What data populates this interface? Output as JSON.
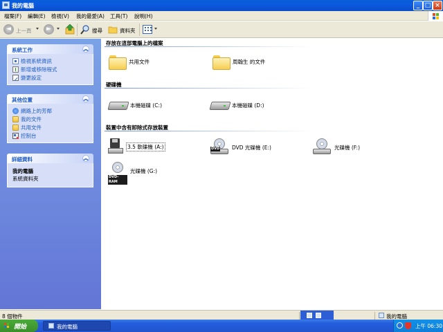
{
  "window": {
    "title": "我的電腦"
  },
  "menu": [
    "檔案(F)",
    "編輯(E)",
    "檢視(V)",
    "我的最愛(A)",
    "工具(T)",
    "說明(H)"
  ],
  "toolbar": {
    "back": "上一頁",
    "search": "搜尋",
    "folders": "資料夾"
  },
  "sidebar": {
    "system_tasks": {
      "title": "系統工作",
      "items": [
        "檢視系統資訊",
        "新增或移除程式",
        "變更設定"
      ]
    },
    "other_places": {
      "title": "其他位置",
      "items": [
        "網路上的芳鄰",
        "我的文件",
        "共用文件",
        "控制台"
      ]
    },
    "details": {
      "title": "詳細資料",
      "name": "我的電腦",
      "type": "系統資料夾"
    }
  },
  "content": {
    "groups": [
      {
        "title": "存放在這部電腦上的檔案"
      },
      {
        "title": "硬碟機"
      },
      {
        "title": "裝置中含有卸除式存放裝置"
      }
    ],
    "folders": [
      "共用文件",
      "周翰生 的文件"
    ],
    "drives": [
      "本機磁碟 (C:)",
      "本機磁碟 (D:)"
    ],
    "removable": [
      {
        "label": "3.5 軟碟機 (A:)"
      },
      {
        "label": "DVD 光碟機 (E:)",
        "tag": "DVD"
      },
      {
        "label": "光碟機 (F:)"
      },
      {
        "label": "光碟機 (G:)",
        "tag": "DVD-RAM"
      }
    ]
  },
  "statusbar": {
    "left": "8 個物件",
    "right": "我的電腦"
  },
  "taskbar": {
    "start": "開始",
    "task": "我的電腦",
    "clock": "上午 06:30"
  }
}
